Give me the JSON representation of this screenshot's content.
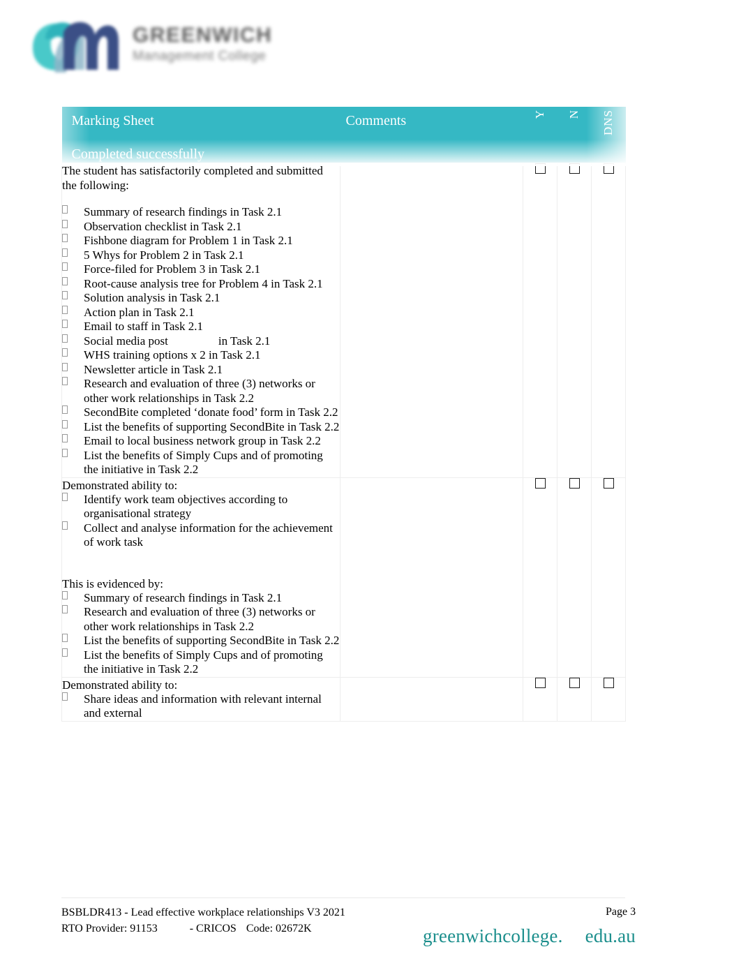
{
  "logo": {
    "mark_name": "gm-swoosh-logo",
    "name": "GREENWICH",
    "tagline": "Management College",
    "colors": {
      "teal": "#2fb3bb",
      "navy": "#3b4f86",
      "cyan": "#4dd0d8"
    }
  },
  "table": {
    "header": {
      "title": "Marking Sheet",
      "subtitle": "Completed successfully",
      "comments": "Comments",
      "col_y": "Y",
      "col_n": "N",
      "col_dns": "DNS",
      "bg_color": "#35b8c4"
    },
    "rows": [
      {
        "lead": "The student has satisfactorily completed and submitted the following:",
        "items": [
          "Summary of research findings in Task 2.1",
          "Observation checklist in Task 2.1",
          "Fishbone diagram for Problem 1 in Task 2.1",
          "5 Whys for Problem 2 in Task 2.1",
          "Force-filed for Problem 3 in Task 2.1",
          "Root-cause analysis tree for Problem 4 in Task 2.1",
          "Solution analysis in Task 2.1",
          "Action plan in Task 2.1",
          "Email to staff in Task 2.1",
          "Social media post",
          "WHS training options x 2 in Task 2.1",
          "Newsletter article in Task 2.1",
          "Research and evaluation of three (3) networks or other work relationships in Task 2.2",
          "SecondBite completed ‘donate food’ form in Task 2.2",
          "List the benefits of supporting SecondBite in Task 2.2",
          "Email to local business network group in Task 2.2",
          "List the benefits of Simply Cups and of promoting the initiative in Task 2.2"
        ],
        "social_media_suffix": "in Task 2.1"
      },
      {
        "lead": "Demonstrated ability to:",
        "items": [
          "Identify work team objectives according to organisational strategy",
          "Collect and analyse information for the achievement of work task"
        ],
        "evidence_lead": "This is evidenced by:",
        "evidence_items": [
          "Summary of research findings in Task 2.1",
          "Research and evaluation of three (3) networks or other work relationships in Task 2.2",
          "List the benefits of supporting SecondBite in Task 2.2",
          "List the benefits of Simply Cups and of promoting the initiative in Task 2.2"
        ]
      },
      {
        "lead": "Demonstrated ability to:",
        "items": [
          "Share ideas and information with relevant internal and external"
        ]
      }
    ]
  },
  "footer": {
    "unit_line": "BSBLDR413 - Lead effective workplace relationships V3 2021",
    "rto_label": "RTO Provider: 91153",
    "cricos_label": "- CRICOS",
    "code_label": "Code: 02672K",
    "page": "Page 3",
    "url_part1": "greenwichcollege.",
    "url_part2": "edu.au",
    "url_color": "#1b8e8c"
  }
}
